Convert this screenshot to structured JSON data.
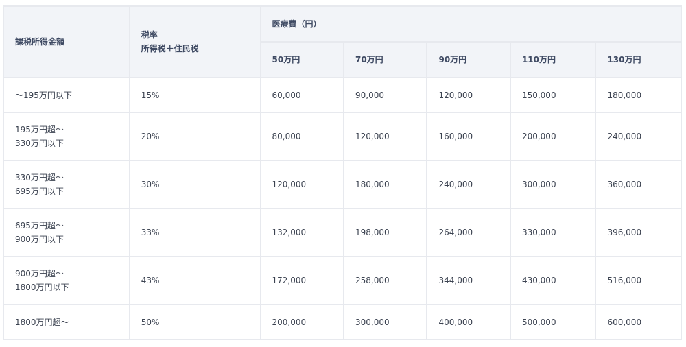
{
  "table": {
    "header": {
      "income_label": "課税所得金額",
      "rate_label_line1": "税率",
      "rate_label_line2": "所得税＋住民税",
      "medical_label": "医療費（円）",
      "medical_columns": [
        "50万円",
        "70万円",
        "90万円",
        "110万円",
        "130万円"
      ]
    },
    "rows": [
      {
        "income_line1": "〜195万円以下",
        "income_line2": "",
        "rate": "15%",
        "values": [
          "60,000",
          "90,000",
          "120,000",
          "150,000",
          "180,000"
        ]
      },
      {
        "income_line1": "195万円超〜",
        "income_line2": "330万円以下",
        "rate": "20%",
        "values": [
          "80,000",
          "120,000",
          "160,000",
          "200,000",
          "240,000"
        ]
      },
      {
        "income_line1": "330万円超〜",
        "income_line2": "695万円以下",
        "rate": "30%",
        "values": [
          "120,000",
          "180,000",
          "240,000",
          "300,000",
          "360,000"
        ]
      },
      {
        "income_line1": "695万円超〜",
        "income_line2": "900万円以下",
        "rate": "33%",
        "values": [
          "132,000",
          "198,000",
          "264,000",
          "330,000",
          "396,000"
        ]
      },
      {
        "income_line1": "900万円超〜",
        "income_line2": "1800万円以下",
        "rate": "43%",
        "values": [
          "172,000",
          "258,000",
          "344,000",
          "430,000",
          "516,000"
        ]
      },
      {
        "income_line1": "1800万円超〜",
        "income_line2": "",
        "rate": "50%",
        "values": [
          "200,000",
          "300,000",
          "400,000",
          "500,000",
          "600,000"
        ]
      }
    ]
  },
  "colors": {
    "header_bg": "#f2f4f8",
    "border": "#e7e9ee",
    "header_text": "#3f4a63",
    "body_text": "#3b4250"
  }
}
